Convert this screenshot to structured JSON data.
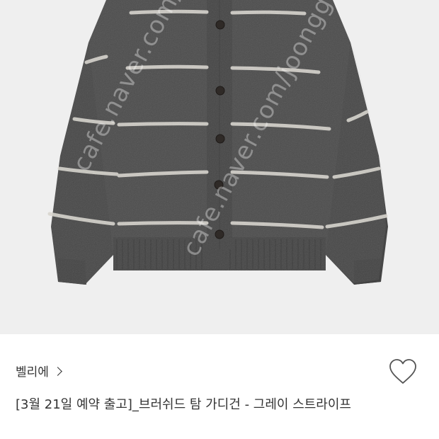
{
  "listing": {
    "image_alt": "",
    "watermark": "cafe.naver.com/joonggonara"
  },
  "shop": {
    "name": "벨리에",
    "chevron_icon": "chevron-right-icon"
  },
  "favorite": {
    "icon": "heart-outline-icon"
  },
  "product": {
    "title": "[3월 21일 예약 출고]_브러쉬드 탐 가디건 - 그레이 스트라이프"
  },
  "colors": {
    "knit": "#4b4b4b",
    "stripe": "#d9d6cf",
    "background": "#efefef"
  }
}
